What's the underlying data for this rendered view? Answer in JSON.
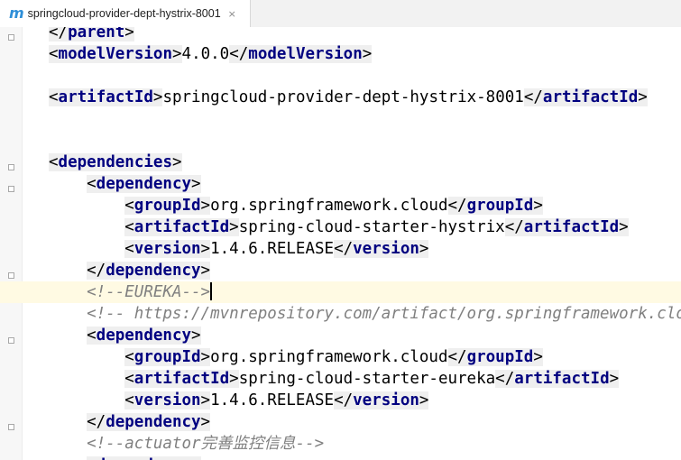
{
  "tab": {
    "icon": "maven-m-icon",
    "icon_glyph": "m",
    "title": "springcloud-provider-dept-hystrix-8001",
    "close": "×"
  },
  "code": {
    "lines": [
      {
        "indent": 2,
        "segments": [
          [
            "tag",
            "</"
          ],
          [
            "tn",
            "parent"
          ],
          [
            "tag",
            ">"
          ]
        ]
      },
      {
        "indent": 2,
        "segments": [
          [
            "tag",
            "<"
          ],
          [
            "tn",
            "modelVersion"
          ],
          [
            "tag",
            ">"
          ],
          [
            "txt",
            "4.0.0"
          ],
          [
            "tag",
            "</"
          ],
          [
            "tn",
            "modelVersion"
          ],
          [
            "tag",
            ">"
          ]
        ]
      },
      {
        "indent": 2,
        "segments": []
      },
      {
        "indent": 2,
        "segments": [
          [
            "tag",
            "<"
          ],
          [
            "tn",
            "artifactId"
          ],
          [
            "tag",
            ">"
          ],
          [
            "txt",
            "springcloud-provider-dept-hystrix-8001"
          ],
          [
            "tag",
            "</"
          ],
          [
            "tn",
            "artifactId"
          ],
          [
            "tag",
            ">"
          ]
        ]
      },
      {
        "indent": 2,
        "segments": []
      },
      {
        "indent": 2,
        "segments": []
      },
      {
        "indent": 2,
        "segments": [
          [
            "tag",
            "<"
          ],
          [
            "tn",
            "dependencies"
          ],
          [
            "tag",
            ">"
          ]
        ]
      },
      {
        "indent": 4,
        "segments": [
          [
            "tag",
            "<"
          ],
          [
            "tn",
            "dependency"
          ],
          [
            "tag",
            ">"
          ]
        ]
      },
      {
        "indent": 6,
        "segments": [
          [
            "tag",
            "<"
          ],
          [
            "tn",
            "groupId"
          ],
          [
            "tag",
            ">"
          ],
          [
            "txt",
            "org.springframework.cloud"
          ],
          [
            "tag",
            "</"
          ],
          [
            "tn",
            "groupId"
          ],
          [
            "tag",
            ">"
          ]
        ]
      },
      {
        "indent": 6,
        "segments": [
          [
            "tag",
            "<"
          ],
          [
            "tn",
            "artifactId"
          ],
          [
            "tag",
            ">"
          ],
          [
            "txt",
            "spring-cloud-starter-hystrix"
          ],
          [
            "tag",
            "</"
          ],
          [
            "tn",
            "artifactId"
          ],
          [
            "tag",
            ">"
          ]
        ]
      },
      {
        "indent": 6,
        "segments": [
          [
            "tag",
            "<"
          ],
          [
            "tn",
            "version"
          ],
          [
            "tag",
            ">"
          ],
          [
            "txt",
            "1.4.6.RELEASE"
          ],
          [
            "tag",
            "</"
          ],
          [
            "tn",
            "version"
          ],
          [
            "tag",
            ">"
          ]
        ]
      },
      {
        "indent": 4,
        "segments": [
          [
            "tag",
            "</"
          ],
          [
            "tn",
            "dependency"
          ],
          [
            "tag",
            ">"
          ]
        ]
      },
      {
        "indent": 4,
        "current": true,
        "segments": [
          [
            "cm",
            "<!--EUREKA-->"
          ],
          [
            "caret",
            ""
          ]
        ]
      },
      {
        "indent": 4,
        "segments": [
          [
            "cm",
            "<!-- https://mvnrepository.com/artifact/org.springframework.cloud/spring-cloud-starter-eureka -->"
          ]
        ]
      },
      {
        "indent": 4,
        "segments": [
          [
            "tag",
            "<"
          ],
          [
            "tn",
            "dependency"
          ],
          [
            "tag",
            ">"
          ]
        ]
      },
      {
        "indent": 6,
        "segments": [
          [
            "tag",
            "<"
          ],
          [
            "tn",
            "groupId"
          ],
          [
            "tag",
            ">"
          ],
          [
            "txt",
            "org.springframework.cloud"
          ],
          [
            "tag",
            "</"
          ],
          [
            "tn",
            "groupId"
          ],
          [
            "tag",
            ">"
          ]
        ]
      },
      {
        "indent": 6,
        "segments": [
          [
            "tag",
            "<"
          ],
          [
            "tn",
            "artifactId"
          ],
          [
            "tag",
            ">"
          ],
          [
            "txt",
            "spring-cloud-starter-eureka"
          ],
          [
            "tag",
            "</"
          ],
          [
            "tn",
            "artifactId"
          ],
          [
            "tag",
            ">"
          ]
        ]
      },
      {
        "indent": 6,
        "segments": [
          [
            "tag",
            "<"
          ],
          [
            "tn",
            "version"
          ],
          [
            "tag",
            ">"
          ],
          [
            "txt",
            "1.4.6.RELEASE"
          ],
          [
            "tag",
            "</"
          ],
          [
            "tn",
            "version"
          ],
          [
            "tag",
            ">"
          ]
        ]
      },
      {
        "indent": 4,
        "segments": [
          [
            "tag",
            "</"
          ],
          [
            "tn",
            "dependency"
          ],
          [
            "tag",
            ">"
          ]
        ]
      },
      {
        "indent": 4,
        "segments": [
          [
            "cm",
            "<!--actuator"
          ],
          [
            "cmcjk",
            "完善监控信息"
          ],
          [
            "cm",
            "-->"
          ]
        ]
      },
      {
        "indent": 4,
        "segments": [
          [
            "tag",
            "<"
          ],
          [
            "tn",
            "dependency"
          ],
          [
            "tag",
            ">"
          ]
        ]
      }
    ]
  },
  "colors": {
    "tag_name": "#000080",
    "comment": "#808080",
    "current_line": "#fffae3",
    "tag_bg": "#efefef"
  }
}
